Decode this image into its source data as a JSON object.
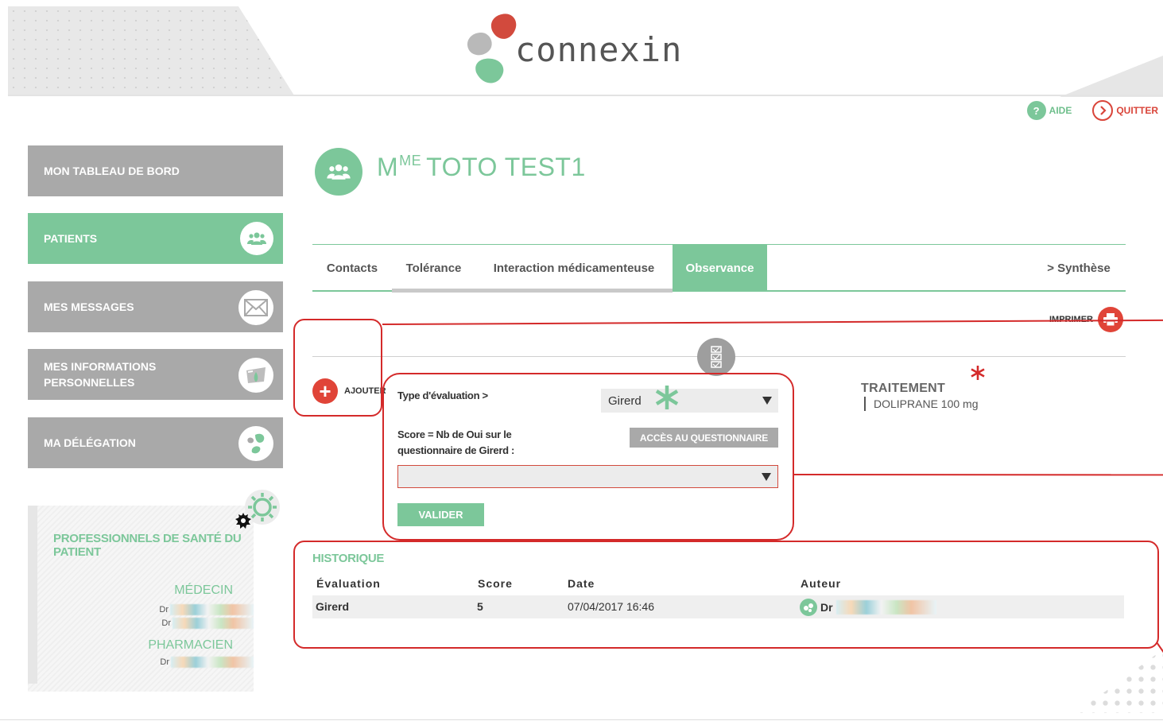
{
  "brand": {
    "name": "connexin",
    "colors": {
      "green": "#7cc79a",
      "red": "#e04438",
      "grey": "#a9a9a9",
      "annotation_red": "#d42a2a"
    }
  },
  "top_links": {
    "help_label": "AIDE",
    "help_icon": "question-icon",
    "quit_label": "QUITTER",
    "quit_icon": "chevron-circle-icon"
  },
  "sidebar": {
    "items": [
      {
        "label": "MON TABLEAU DE BORD",
        "active": false,
        "icon": ""
      },
      {
        "label": "PATIENTS",
        "active": true,
        "icon": "users-icon"
      },
      {
        "label": "MES MESSAGES",
        "active": false,
        "icon": "envelope-icon"
      },
      {
        "label": "MES INFORMATIONS PERSONNELLES",
        "active": false,
        "icon": "id-card-icon"
      },
      {
        "label": "MA DÉLÉGATION",
        "active": false,
        "icon": "leaf-icon"
      }
    ],
    "professionals": {
      "title": "PROFESSIONNELS DE SANTÉ DU PATIENT",
      "medecin_heading": "MÉDECIN",
      "medecin_entries": [
        "Dr",
        "Dr"
      ],
      "pharmacien_heading": "PHARMACIEN",
      "pharmacien_entries": [
        "Dr"
      ]
    }
  },
  "patient": {
    "civility": "M",
    "civility_sup": "ME",
    "name": "TOTO TEST1"
  },
  "tabs": [
    {
      "label": "Contacts",
      "active": false
    },
    {
      "label": "Tolérance",
      "active": false
    },
    {
      "label": "Interaction médicamenteuse",
      "active": false
    },
    {
      "label": "Observance",
      "active": true
    },
    {
      "label": "> Synthèse",
      "active": false
    }
  ],
  "print_label": "IMPRIMER",
  "add_label": "AJOUTER",
  "form": {
    "type_label": "Type d'évaluation >",
    "type_value": "Girerd",
    "score_label_line1": "Score = Nb de Oui sur le",
    "score_label_line2": "questionnaire de Girerd :",
    "score_value": "",
    "questionnaire_button": "ACCÈS AU QUESTIONNAIRE",
    "submit_button": "VALIDER"
  },
  "treatment": {
    "title": "TRAITEMENT",
    "items": [
      "DOLIPRANE 100 mg"
    ]
  },
  "history": {
    "title": "HISTORIQUE",
    "columns": [
      "Évaluation",
      "Score",
      "Date",
      "Auteur"
    ],
    "rows": [
      {
        "evaluation": "Girerd",
        "score": "5",
        "date": "07/04/2017 16:46",
        "author": "Dr"
      }
    ]
  }
}
